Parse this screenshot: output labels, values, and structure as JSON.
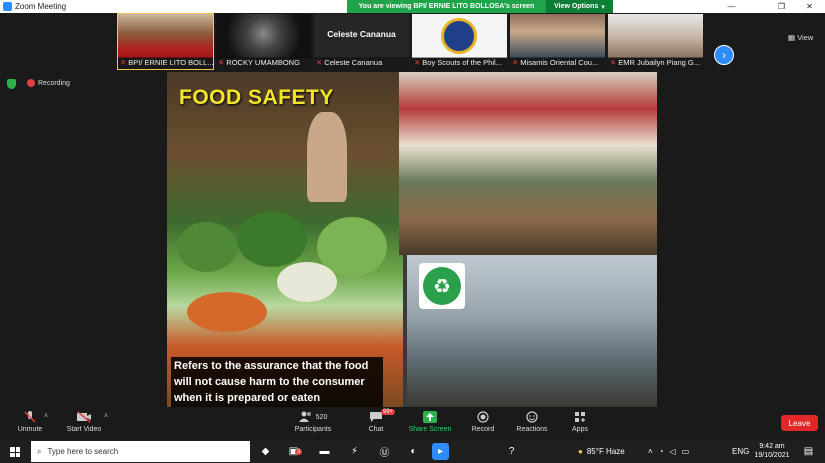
{
  "window": {
    "title": "Zoom Meeting"
  },
  "banner": {
    "viewing_text": "You are viewing BPI/ ERNIE LITO BOLLOSA's screen",
    "view_options": "View Options"
  },
  "strip": {
    "participants": [
      {
        "name": "BPI/ ERNIE LITO BOLL...",
        "muted": true
      },
      {
        "name": "ROCKY UMAMBONG",
        "muted": true
      },
      {
        "name": "Celeste Cananua",
        "muted": true,
        "display": "Celeste Cananua"
      },
      {
        "name": "Boy Scouts of the Phil...",
        "muted": true
      },
      {
        "name": "Misamis Oriental Cou...",
        "muted": true
      },
      {
        "name": "EMR Jubailyn Piang G...",
        "muted": true
      }
    ],
    "view_label": "View"
  },
  "status": {
    "recording": "Recording"
  },
  "slide": {
    "title": "FOOD SAFETY",
    "caption": "Refers to the assurance that the food will not cause harm to the consumer when it is prepared or eaten"
  },
  "toolbar": {
    "unmute": "Unmute",
    "start_video": "Start Video",
    "participants": "Participants",
    "participant_count": "520",
    "chat": "Chat",
    "chat_badge": "99+",
    "share_screen": "Share Screen",
    "record": "Record",
    "reactions": "Reactions",
    "apps": "Apps",
    "leave": "Leave"
  },
  "taskbar": {
    "search_placeholder": "Type here to search",
    "weather": "85°F  Haze",
    "lang": "ENG",
    "time": "9:42 am",
    "date": "19/10/2021",
    "badge_count": "3"
  }
}
